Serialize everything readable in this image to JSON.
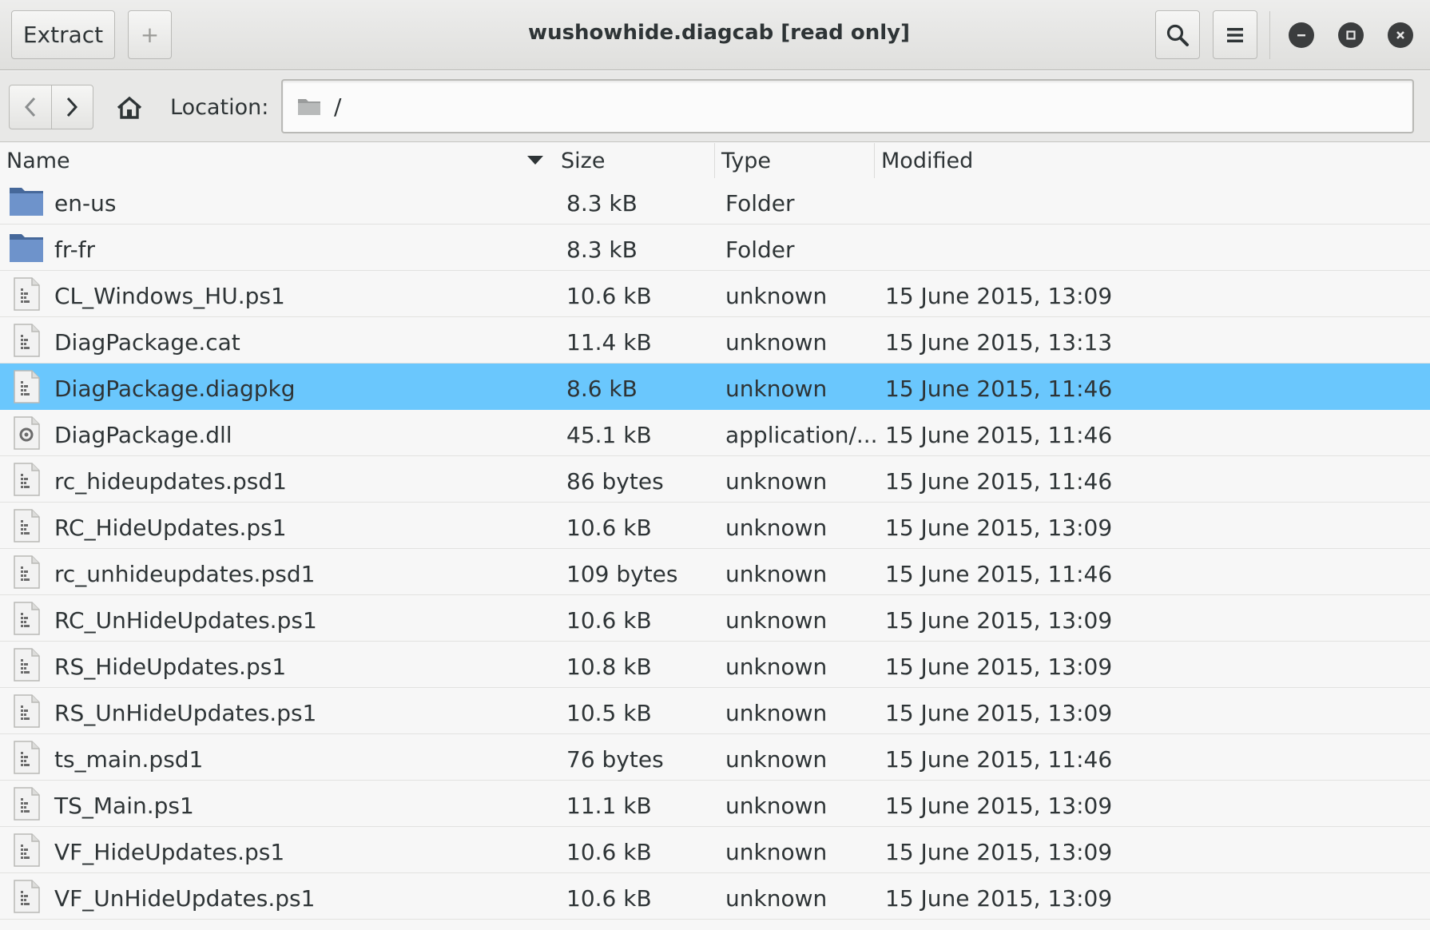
{
  "header": {
    "extract_label": "Extract",
    "add_label": "+",
    "title": "wushowhide.diagcab [read only]"
  },
  "location": {
    "label": "Location:",
    "path": "/"
  },
  "columns": {
    "name": "Name",
    "size": "Size",
    "type": "Type",
    "modified": "Modified"
  },
  "files": [
    {
      "icon": "folder-icon",
      "name": "en-us",
      "size": "8.3 kB",
      "type": "Folder",
      "modified": ""
    },
    {
      "icon": "folder-icon",
      "name": "fr-fr",
      "size": "8.3 kB",
      "type": "Folder",
      "modified": ""
    },
    {
      "icon": "file-icon",
      "name": "CL_Windows_HU.ps1",
      "size": "10.6 kB",
      "type": "unknown",
      "modified": "15 June 2015, 13:09"
    },
    {
      "icon": "file-icon",
      "name": "DiagPackage.cat",
      "size": "11.4 kB",
      "type": "unknown",
      "modified": "15 June 2015, 13:13"
    },
    {
      "icon": "file-icon",
      "name": "DiagPackage.diagpkg",
      "size": "8.6 kB",
      "type": "unknown",
      "modified": "15 June 2015, 11:46",
      "selected": true
    },
    {
      "icon": "library-icon",
      "name": "DiagPackage.dll",
      "size": "45.1 kB",
      "type": "application/...",
      "modified": "15 June 2015, 11:46"
    },
    {
      "icon": "file-icon",
      "name": "rc_hideupdates.psd1",
      "size": "86 bytes",
      "type": "unknown",
      "modified": "15 June 2015, 11:46"
    },
    {
      "icon": "file-icon",
      "name": "RC_HideUpdates.ps1",
      "size": "10.6 kB",
      "type": "unknown",
      "modified": "15 June 2015, 13:09"
    },
    {
      "icon": "file-icon",
      "name": "rc_unhideupdates.psd1",
      "size": "109 bytes",
      "type": "unknown",
      "modified": "15 June 2015, 11:46"
    },
    {
      "icon": "file-icon",
      "name": "RC_UnHideUpdates.ps1",
      "size": "10.6 kB",
      "type": "unknown",
      "modified": "15 June 2015, 13:09"
    },
    {
      "icon": "file-icon",
      "name": "RS_HideUpdates.ps1",
      "size": "10.8 kB",
      "type": "unknown",
      "modified": "15 June 2015, 13:09"
    },
    {
      "icon": "file-icon",
      "name": "RS_UnHideUpdates.ps1",
      "size": "10.5 kB",
      "type": "unknown",
      "modified": "15 June 2015, 13:09"
    },
    {
      "icon": "file-icon",
      "name": "ts_main.psd1",
      "size": "76 bytes",
      "type": "unknown",
      "modified": "15 June 2015, 11:46"
    },
    {
      "icon": "file-icon",
      "name": "TS_Main.ps1",
      "size": "11.1 kB",
      "type": "unknown",
      "modified": "15 June 2015, 13:09"
    },
    {
      "icon": "file-icon",
      "name": "VF_HideUpdates.ps1",
      "size": "10.6 kB",
      "type": "unknown",
      "modified": "15 June 2015, 13:09"
    },
    {
      "icon": "file-icon",
      "name": "VF_UnHideUpdates.ps1",
      "size": "10.6 kB",
      "type": "unknown",
      "modified": "15 June 2015, 13:09"
    }
  ],
  "colors": {
    "selection": "#6ac7fd",
    "folder": "#5a87c5"
  }
}
